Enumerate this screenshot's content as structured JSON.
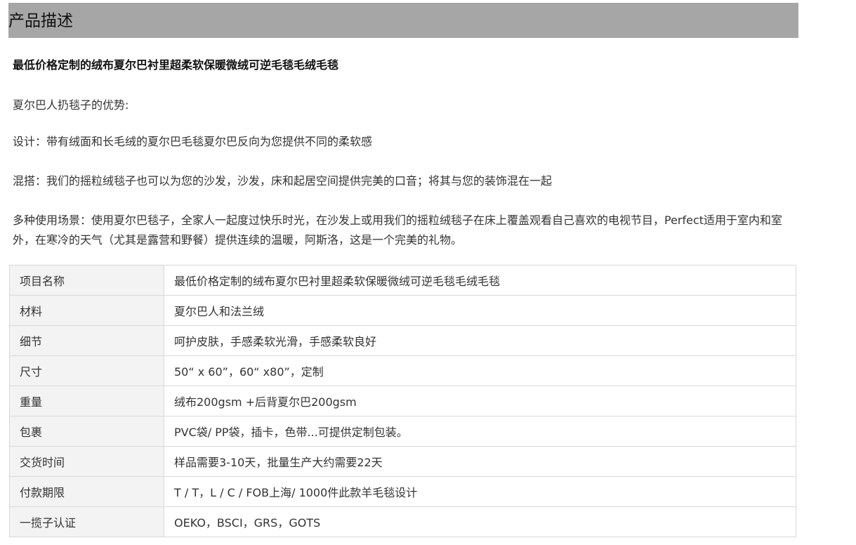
{
  "section": {
    "title": "产品描述"
  },
  "product": {
    "title": "最低价格定制的绒布夏尔巴衬里超柔软保暖微绒可逆毛毯毛绒毛毯",
    "paragraphs": [
      "夏尔巴人扔毯子的优势:",
      "设计：带有绒面和长毛绒的夏尔巴毛毯夏尔巴反向为您提供不同的柔软感",
      "混搭：我们的摇粒绒毯子也可以为您的沙发，沙发，床和起居空间提供完美的口音；将其与您的装饰混在一起",
      "多种使用场景：使用夏尔巴毯子，全家人一起度过快乐时光，在沙发上或用我们的摇粒绒毯子在床上覆盖观看自己喜欢的电视节目，Perfect适用于室内和室外，在寒冷的天气（尤其是露营和野餐）提供连续的温暖，阿斯洛，这是一个完美的礼物。"
    ]
  },
  "specs": [
    {
      "label": "项目名称",
      "value": "最低价格定制的绒布夏尔巴衬里超柔软保暖微绒可逆毛毯毛绒毛毯"
    },
    {
      "label": "材料",
      "value": "夏尔巴人和法兰绒"
    },
    {
      "label": "细节",
      "value": "呵护皮肤，手感柔软光滑，手感柔软良好"
    },
    {
      "label": "尺寸",
      "value": "50“ x 60”，60“ x80”，定制"
    },
    {
      "label": "重量",
      "value": "绒布200gsm +后背夏尔巴200gsm"
    },
    {
      "label": "包裹",
      "value": "PVC袋/ PP袋，插卡，色带...可提供定制包装。"
    },
    {
      "label": "交货时间",
      "value": "样品需要3-10天，批量生产大约需要22天"
    },
    {
      "label": "付款期限",
      "value": "T / T，L / C / FOB上海/ 1000件此款羊毛毯设计"
    },
    {
      "label": "一揽子认证",
      "value": "OEKO，BSCI，GRS，GOTS"
    }
  ],
  "colors": {
    "header_bg": "#a6a6a6",
    "key_cell_bg": "#f3f3f3",
    "border": "#d9d9d9"
  }
}
